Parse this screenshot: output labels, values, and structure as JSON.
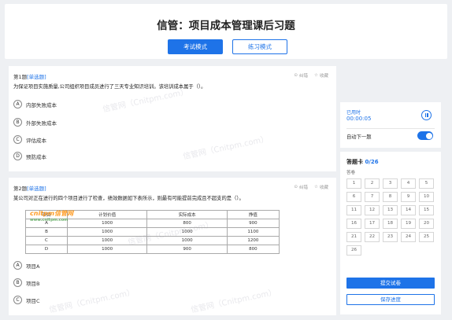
{
  "header": {
    "title": "信管：项目成本管理课后习题",
    "modes": [
      "考试模式",
      "练习模式"
    ]
  },
  "tools": {
    "correct": "纠错",
    "favorite": "收藏"
  },
  "questions": [
    {
      "number_label": "第1题",
      "type": "[单选题]",
      "text": "为保证项目实施质量,公司组织项目成员进行了三天专业知识培训。该培训成本属于（）。",
      "options": [
        {
          "letter": "A",
          "text": "内部失败成本"
        },
        {
          "letter": "B",
          "text": "外部失败成本"
        },
        {
          "letter": "C",
          "text": "评估成本"
        },
        {
          "letter": "D",
          "text": "预防成本"
        }
      ]
    },
    {
      "number_label": "第2题",
      "type": "[单选题]",
      "text": "某公司对正在进行的四个项目进行了检查，绩效数据如下表所示，则最有可能提前完成且不超支的是（）。",
      "table": {
        "headers": [
          "项目",
          "计划价值",
          "实际成本",
          "挣值"
        ],
        "rows": [
          [
            "A",
            "1000",
            "800",
            "900"
          ],
          [
            "B",
            "1000",
            "1000",
            "1100"
          ],
          [
            "C",
            "1000",
            "1000",
            "1200"
          ],
          [
            "D",
            "1000",
            "900",
            "800"
          ]
        ]
      },
      "options": [
        {
          "letter": "A",
          "text": "项目A"
        },
        {
          "letter": "B",
          "text": "项目B"
        },
        {
          "letter": "C",
          "text": "项目C"
        }
      ]
    }
  ],
  "timer": {
    "label": "已用时",
    "value": "00:00:05",
    "auto_next_label": "自动下一题",
    "auto_next_on": true
  },
  "answer_sheet": {
    "title": "答题卡",
    "count": "0/26",
    "sub": "答卷",
    "cells": [
      "1",
      "2",
      "3",
      "4",
      "5",
      "6",
      "7",
      "8",
      "9",
      "10",
      "11",
      "12",
      "13",
      "14",
      "15",
      "16",
      "17",
      "18",
      "19",
      "20",
      "21",
      "22",
      "23",
      "24",
      "25",
      "26"
    ],
    "submit_label": "提交试卷",
    "save_label": "保存进度"
  },
  "watermark_text": "信管网（Cnitpm.com）",
  "logo": {
    "main": "cnitpm信管网",
    "sub": "www.cnitpm.com"
  },
  "colors": {
    "accent": "#1e73e8"
  }
}
